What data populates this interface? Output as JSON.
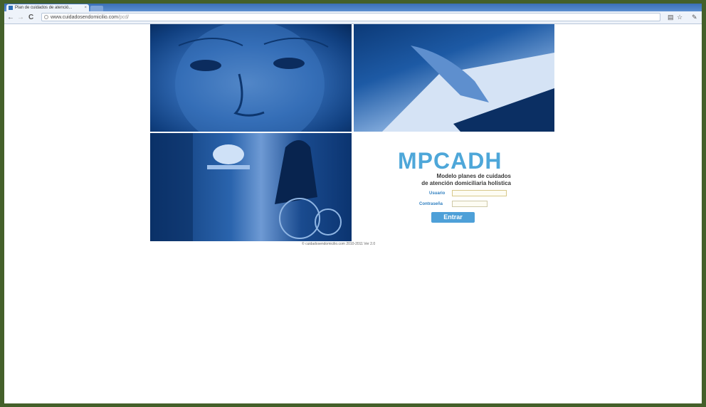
{
  "browser": {
    "tab_title": "Plan de cuidados de atenció...",
    "tab_close": "×",
    "url_host": "www.cuidadosendomicilio.com",
    "url_path": "/pcd/",
    "nav_back": "←",
    "nav_forward": "→",
    "nav_reload": "C",
    "toolbar_icons": [
      "page-icon",
      "star-icon",
      "wrench-icon"
    ]
  },
  "login": {
    "brand": "MPCADH",
    "subtitle_line1": "Modelo planes de cuidados",
    "subtitle_line2": "de atención domiciliaria holística",
    "username_label": "Usuario",
    "username_value": "",
    "password_label": "Contraseña",
    "password_value": "",
    "submit_label": "Entrar"
  },
  "footer": {
    "text": "© cuidadosendomicilio.com 2010-2011 Ver 2.0"
  },
  "colors": {
    "accent": "#4ea7d9",
    "photo_blue": "#2f67b0",
    "outer_border": "#44602a"
  }
}
